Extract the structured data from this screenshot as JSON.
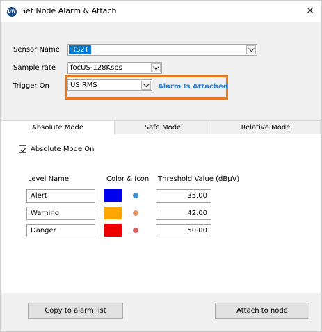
{
  "window": {
    "title": "Set Node Alarm & Attach",
    "app_icon_text": "UW"
  },
  "form": {
    "sensor_name_label": "Sensor Name",
    "sensor_name_value": "RS2T",
    "sample_rate_label": "Sample rate",
    "sample_rate_value": "focUS-128Ksps",
    "trigger_on_label": "Trigger On",
    "trigger_on_value": "US RMS",
    "alarm_status": "Alarm Is Attached",
    "alarm_status_color": "#2a7fd4",
    "highlight_color": "#e07b20"
  },
  "tabs": [
    {
      "label": "Absolute Mode",
      "active": true
    },
    {
      "label": "Safe Mode",
      "active": false
    },
    {
      "label": "Relative Mode",
      "active": false
    }
  ],
  "absolute_mode": {
    "checkbox_label": "Absolute Mode On",
    "checked": true,
    "headers": {
      "level_name": "Level Name",
      "color_icon": "Color & Icon",
      "threshold": "Threshold Value (dBµV)"
    },
    "levels": [
      {
        "name": "Alert",
        "color": "#0000ee",
        "icon_color": "#3d93d8",
        "threshold": "35.00"
      },
      {
        "name": "Warning",
        "color": "#ffa500",
        "icon_color": "#e9955a",
        "threshold": "42.00"
      },
      {
        "name": "Danger",
        "color": "#ee0000",
        "icon_color": "#e06060",
        "threshold": "50.00"
      }
    ]
  },
  "footer": {
    "copy_button": "Copy to alarm list",
    "attach_button": "Attach to node"
  }
}
